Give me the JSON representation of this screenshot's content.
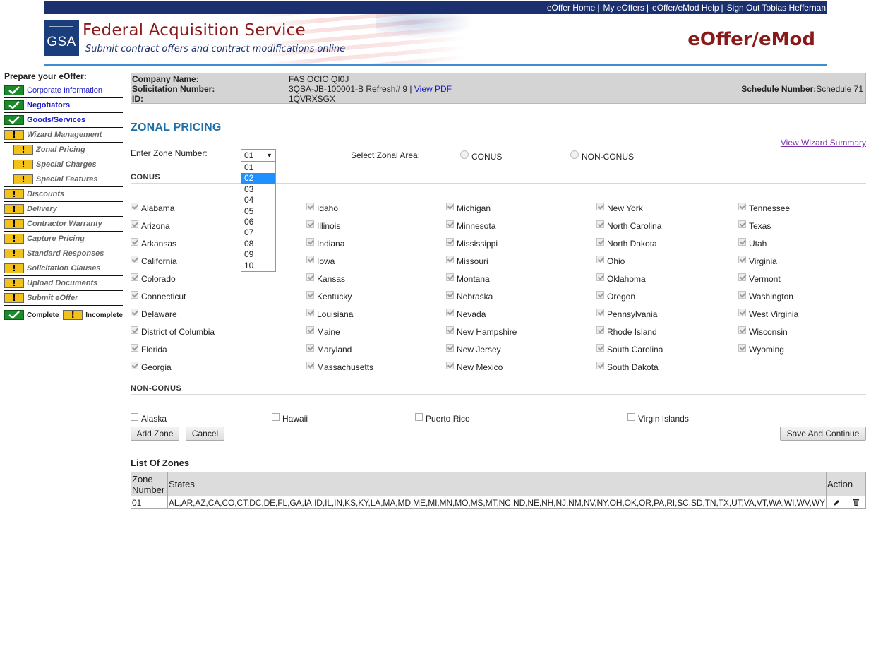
{
  "header": {
    "nav": [
      "eOffer Home",
      "My eOffers",
      "eOffer/eMod Help",
      "Sign Out Tobias Heffernan"
    ],
    "logo_text": "GSA",
    "agency_title": "Federal Acquisition Service",
    "agency_subtitle": "Submit contract offers and contract modifications online",
    "app_title": "eOffer/eMod"
  },
  "sidebar": {
    "heading": "Prepare your eOffer:",
    "items": [
      {
        "label": "Corporate Information",
        "status": "complete"
      },
      {
        "label": "Negotiators",
        "status": "complete"
      },
      {
        "label": "Goods/Services",
        "status": "complete"
      },
      {
        "label": "Wizard Management",
        "status": "incomplete"
      },
      {
        "label": "Zonal Pricing",
        "status": "incomplete"
      },
      {
        "label": "Special Charges",
        "status": "incomplete"
      },
      {
        "label": "Special Features",
        "status": "incomplete"
      },
      {
        "label": "Discounts",
        "status": "incomplete"
      },
      {
        "label": "Delivery",
        "status": "incomplete"
      },
      {
        "label": "Contractor Warranty",
        "status": "incomplete"
      },
      {
        "label": "Capture Pricing",
        "status": "incomplete"
      },
      {
        "label": "Standard Responses",
        "status": "incomplete"
      },
      {
        "label": "Solicitation Clauses",
        "status": "incomplete"
      },
      {
        "label": "Upload Documents",
        "status": "incomplete"
      },
      {
        "label": "Submit eOffer",
        "status": "incomplete"
      }
    ],
    "legend": {
      "complete": "Complete",
      "incomplete": "Incomplete"
    }
  },
  "info": {
    "company_label": "Company Name:",
    "company_value": "FAS OCIO QI0J",
    "solicitation_label": "Solicitation Number:",
    "solicitation_value": "3QSA-JB-100001-B Refresh# 9 |",
    "view_pdf": "View PDF",
    "id_label": "ID:",
    "id_value": "1QVRXSGX",
    "schedule_label": "Schedule Number:",
    "schedule_value": "Schedule 71"
  },
  "main": {
    "title": "ZONAL PRICING",
    "wizard_link": "View Wizard Summary",
    "zone_label": "Enter Zone Number:",
    "zone_selected": "01",
    "zone_options": [
      "01",
      "02",
      "03",
      "04",
      "05",
      "06",
      "07",
      "08",
      "09",
      "10"
    ],
    "zone_highlighted": "02",
    "area_label": "Select Zonal Area:",
    "radio_conus": "CONUS",
    "radio_nonconus": "NON-CONUS",
    "conus_heading": "CONUS",
    "nonconus_heading": "NON-CONUS",
    "conus_states": [
      [
        "Alabama",
        "Arizona",
        "Arkansas",
        "California",
        "Colorado",
        "Connecticut",
        "Delaware",
        "District of Columbia",
        "Florida",
        "Georgia"
      ],
      [
        "Idaho",
        "Illinois",
        "Indiana",
        "Iowa",
        "Kansas",
        "Kentucky",
        "Louisiana",
        "Maine",
        "Maryland",
        "Massachusetts"
      ],
      [
        "Michigan",
        "Minnesota",
        "Mississippi",
        "Missouri",
        "Montana",
        "Nebraska",
        "Nevada",
        "New Hampshire",
        "New Jersey",
        "New Mexico"
      ],
      [
        "New York",
        "North Carolina",
        "North Dakota",
        "Ohio",
        "Oklahoma",
        "Oregon",
        "Pennsylvania",
        "Rhode Island",
        "South Carolina",
        "South Dakota"
      ],
      [
        "Tennessee",
        "Texas",
        "Utah",
        "Virginia",
        "Vermont",
        "Washington",
        "West Virginia",
        "Wisconsin",
        "Wyoming"
      ]
    ],
    "nonconus_areas": [
      "Alaska",
      "Hawaii",
      "Puerto Rico",
      "Virgin Islands"
    ],
    "add_zone": "Add Zone",
    "cancel": "Cancel",
    "save_continue": "Save And Continue",
    "list_title": "List Of Zones",
    "table": {
      "headers": [
        "Zone Number",
        "States",
        "Action"
      ],
      "rows": [
        {
          "zone": "01",
          "states": "AL,AR,AZ,CA,CO,CT,DC,DE,FL,GA,IA,ID,IL,IN,KS,KY,LA,MA,MD,ME,MI,MN,MO,MS,MT,NC,ND,NE,NH,NJ,NM,NV,NY,OH,OK,OR,PA,RI,SC,SD,TN,TX,UT,VA,VT,WA,WI,WV,WY"
        }
      ]
    }
  }
}
